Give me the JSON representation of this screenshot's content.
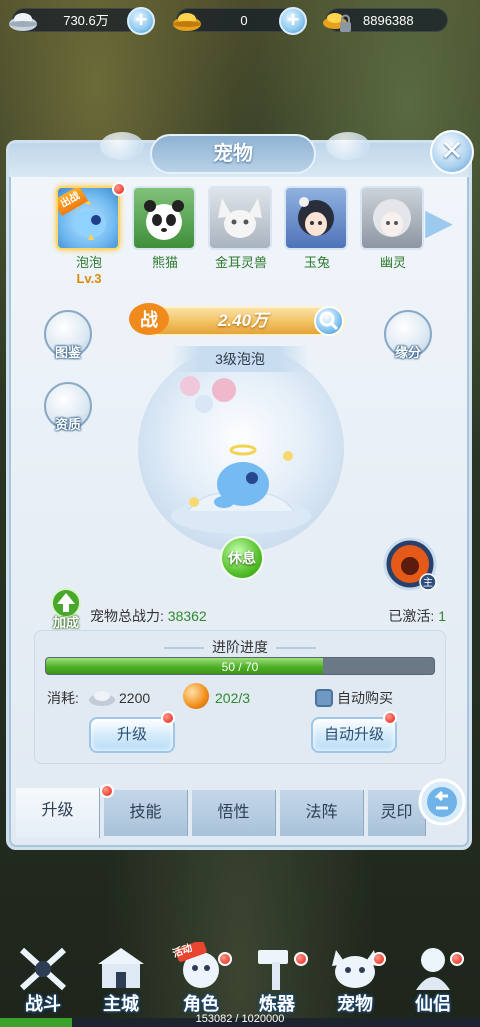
{
  "currency": {
    "silver": "730.6万",
    "gold": "0",
    "locked": "8896388"
  },
  "panel": {
    "title": "宠物"
  },
  "pets": [
    {
      "name": "泡泡",
      "level": "Lv.3",
      "selected": true,
      "badge": "出战"
    },
    {
      "name": "熊猫"
    },
    {
      "name": "金耳灵兽"
    },
    {
      "name": "玉兔"
    },
    {
      "name": "幽灵"
    }
  ],
  "power": {
    "icon_text": "战",
    "value": "2.40万"
  },
  "side_buttons": {
    "codex": "图鉴",
    "aptitude": "资质",
    "fate": "缘分"
  },
  "pet_display": {
    "level_name": "3级泡泡",
    "rest_label": "休息",
    "master_badge": "主"
  },
  "stats": {
    "boost_label": "加成",
    "total_power_label": "宠物总战力:",
    "total_power_value": "38362",
    "activated_label": "已激活:",
    "activated_value": "1"
  },
  "advance": {
    "title": "进阶进度",
    "progress_text": "50 / 70",
    "progress_fraction": 0.714,
    "cost_label": "消耗:",
    "silver_cost": "2200",
    "orb_cost": "202/3",
    "auto_buy_label": "自动购买",
    "upgrade_label": "升级",
    "auto_upgrade_label": "自动升级"
  },
  "tabs": [
    "升级",
    "技能",
    "悟性",
    "法阵",
    "灵印"
  ],
  "nav": [
    {
      "label": "战斗"
    },
    {
      "label": "主城"
    },
    {
      "label": "角色",
      "badge": "活动"
    },
    {
      "label": "炼器"
    },
    {
      "label": "宠物"
    },
    {
      "label": "仙侣"
    }
  ],
  "exp": {
    "text": "153082 / 1020000",
    "fraction": 0.15
  },
  "colors": {
    "accent_green": "#2f8a2f",
    "badge_red": "#e61b10",
    "gold": "#f1c160"
  }
}
